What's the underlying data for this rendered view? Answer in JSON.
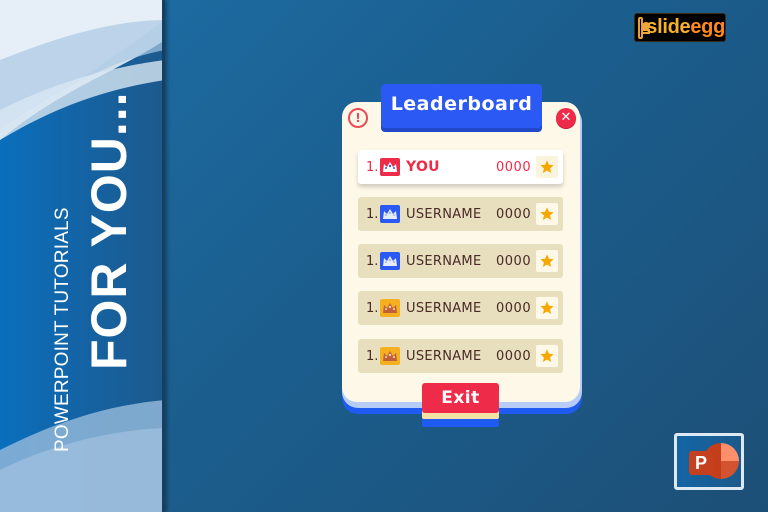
{
  "banner": {
    "subtitle": "POWERPOINT TUTORIALS",
    "title": "FOR YOU..."
  },
  "logo": {
    "part1": "slide",
    "part2": "egg"
  },
  "ppt_badge": {
    "letter": "P",
    "icon": "powerpoint-icon"
  },
  "leaderboard": {
    "title": "Leaderboard",
    "alert_icon": "!",
    "close_icon": "✕",
    "exit_label": "Exit",
    "rows": [
      {
        "rank": "1.",
        "name": "YOU",
        "score": "0000",
        "avatar": "crown-red",
        "highlight": true
      },
      {
        "rank": "1.",
        "name": "USERNAME",
        "score": "0000",
        "avatar": "crown-blue",
        "highlight": false
      },
      {
        "rank": "1.",
        "name": "USERNAME",
        "score": "0000",
        "avatar": "crown-blue",
        "highlight": false
      },
      {
        "rank": "1.",
        "name": "USERNAME",
        "score": "0000",
        "avatar": "crown-orange",
        "highlight": false
      },
      {
        "rank": "1.",
        "name": "USERNAME",
        "score": "0000",
        "avatar": "crown-orange",
        "highlight": false
      }
    ]
  },
  "colors": {
    "accent_blue": "#2b59f3",
    "accent_red": "#ee2b48",
    "panel_cream": "#fdf8e8",
    "row_tan": "#e7dfbe",
    "star_gold": "#f5a800"
  }
}
